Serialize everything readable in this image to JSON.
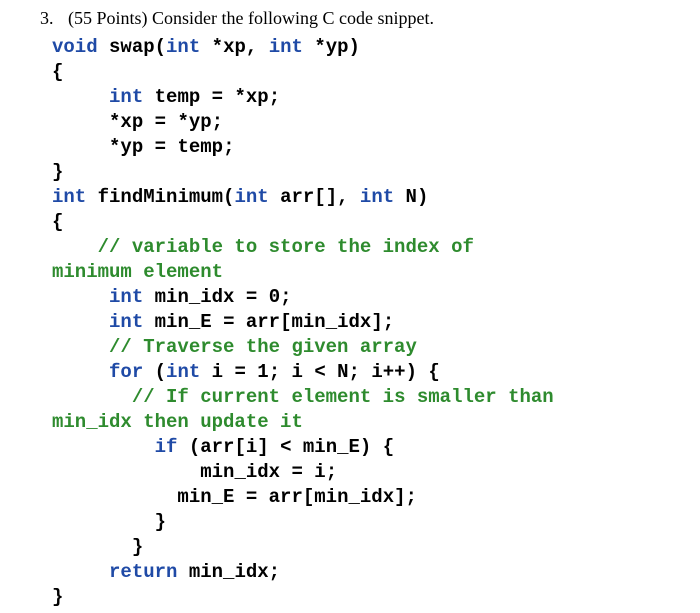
{
  "prompt": {
    "number": "3.",
    "points": "(55 Points) Consider the following C code snippet."
  },
  "code": {
    "kw_void": "void",
    "kw_int": "int",
    "kw_for": "for",
    "kw_if": "if",
    "kw_return": "return",
    "fn_swap": "swap",
    "fn_findMin": "findMinimum",
    "id_xp": "xp",
    "id_yp": "yp",
    "id_temp": "temp",
    "id_arr": "arr",
    "id_N": "N",
    "id_min_idx": "min_idx",
    "id_min_E": "min_E",
    "id_i": "i",
    "num_0": "0",
    "num_1": "1",
    "cmt1": "// variable to store the index of",
    "cmt1b": "minimum element",
    "cmt2": "// Traverse the given array",
    "cmt3": "// If current element is smaller than",
    "cmt3b": "min_idx then update it",
    "p_open": "(",
    "p_close": ")",
    "brace_open": "{",
    "brace_close": "}",
    "star": "*",
    "comma": ",",
    "semi": ";",
    "eq": "=",
    "lt": "<",
    "inc": "++",
    "lbr": "[",
    "rbr": "]",
    "sp": " "
  }
}
